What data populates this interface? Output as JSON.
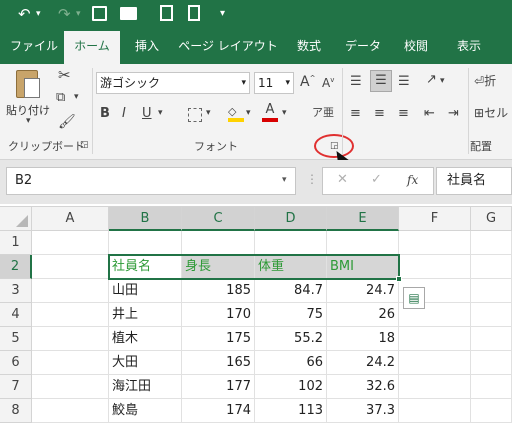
{
  "quick_access": {
    "undo_icon": "undo-icon",
    "redo_icon": "redo-icon",
    "save_icon": "save-icon",
    "open_icon": "folder-icon",
    "print_preview_icon": "print-preview-icon",
    "new_icon": "new-document-icon",
    "customize_icon": "customize-qat-icon"
  },
  "ribbon_tabs": [
    "ファイル",
    "ホーム",
    "挿入",
    "ページ レイアウト",
    "数式",
    "データ",
    "校閲",
    "表示"
  ],
  "active_tab": "ホーム",
  "ribbon": {
    "paste_label": "貼り付け",
    "clipboard_group": "クリップボード",
    "font_group": "フォント",
    "alignment_group": "配置",
    "font_name": "游ゴシック",
    "font_size": "11",
    "bold": "B",
    "italic": "I",
    "underline": "U",
    "wrap_label": "折",
    "merge_label": "セル"
  },
  "formula_bar": {
    "name_box": "B2",
    "cancel": "✕",
    "enter": "✓",
    "fx": "fx",
    "value": "社員名"
  },
  "grid": {
    "columns": [
      "A",
      "B",
      "C",
      "D",
      "E",
      "F",
      "G"
    ],
    "rows": [
      "1",
      "2",
      "3",
      "4",
      "5",
      "6",
      "7",
      "8"
    ],
    "header_row": [
      "社員名",
      "身長",
      "体重",
      "BMI"
    ],
    "data": [
      [
        "山田",
        "185",
        "84.7",
        "24.7"
      ],
      [
        "井上",
        "170",
        "75",
        "26"
      ],
      [
        "植木",
        "175",
        "55.2",
        "18"
      ],
      [
        "大田",
        "165",
        "66",
        "24.2"
      ],
      [
        "海江田",
        "177",
        "102",
        "32.6"
      ],
      [
        "鮫島",
        "174",
        "113",
        "37.3"
      ]
    ]
  },
  "colors": {
    "excel_green": "#217346",
    "header_text_green": "#2d9a36",
    "highlight_ring": "#e03030"
  }
}
